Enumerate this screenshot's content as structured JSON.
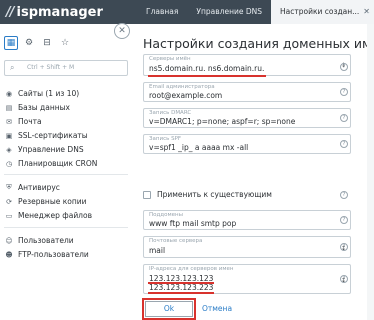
{
  "app": {
    "logo_text": "ispmanager",
    "logo_mark": "//"
  },
  "breadcrumbs": [
    {
      "label": "Главная"
    },
    {
      "label": "Управление DNS"
    },
    {
      "label": "Настройки создан..."
    }
  ],
  "sidebar": {
    "search_placeholder": "Ctrl + Shift + M",
    "groups": [
      [
        {
          "label": "Сайты (1 из 10)",
          "icon": "globe-icon"
        },
        {
          "label": "Базы данных",
          "icon": "database-icon"
        },
        {
          "label": "Почта",
          "icon": "mail-icon"
        },
        {
          "label": "SSL-сертификаты",
          "icon": "certificate-icon"
        },
        {
          "label": "Управление DNS",
          "icon": "dns-icon"
        },
        {
          "label": "Планировщик CRON",
          "icon": "clock-icon"
        }
      ],
      [
        {
          "label": "Антивирус",
          "icon": "shield-icon"
        },
        {
          "label": "Резервные копии",
          "icon": "backup-icon"
        },
        {
          "label": "Менеджер файлов",
          "icon": "folder-icon"
        }
      ],
      [
        {
          "label": "Пользователи",
          "icon": "user-icon"
        },
        {
          "label": "FTP-пользователи",
          "icon": "ftp-user-icon"
        }
      ]
    ]
  },
  "form": {
    "title": "Настройки создания доменных имён",
    "fields": {
      "nameservers": {
        "label": "Серверы имён",
        "value": "ns5.domain.ru. ns6.domain.ru."
      },
      "admin_email": {
        "label": "Email администратора",
        "value": "root@example.com"
      },
      "dmarc": {
        "label": "Запись DMARC",
        "value": "v=DMARC1; p=none; aspf=r; sp=none"
      },
      "spf": {
        "label": "Запись SPF",
        "value": "v=spf1 _ip_ a aaaa mx -all"
      },
      "apply_existing": {
        "label": "Применить к существующим"
      },
      "subdomains": {
        "label": "Поддомены",
        "value": "www ftp mail smtp pop"
      },
      "mail_servers": {
        "label": "Почтовые сервера",
        "value": "mail"
      },
      "ip_addresses": {
        "label": "IP-адреса для серверов имен",
        "values": [
          "123.123.123.123",
          "123.123.123.223"
        ]
      }
    },
    "ok_label": "Ok",
    "cancel_label": "Отмена"
  },
  "colors": {
    "accent": "#2a7cc7",
    "highlight": "#d8322d",
    "topbar": "#3d4954"
  }
}
